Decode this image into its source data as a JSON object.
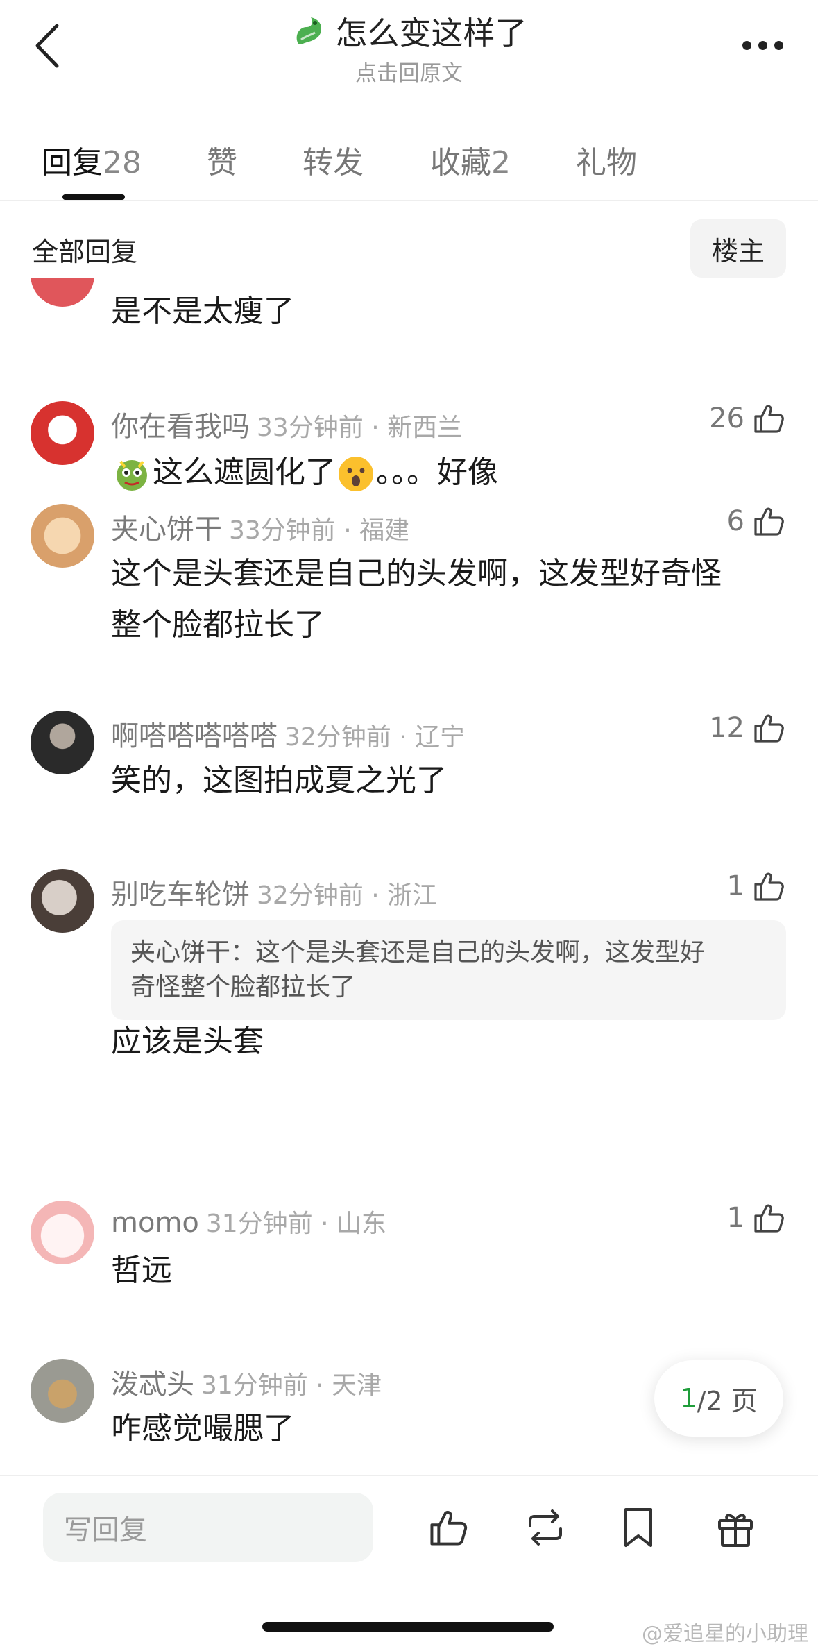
{
  "header": {
    "title": "怎么变这样了",
    "subtitle": "点击回原文"
  },
  "tabs": [
    {
      "label": "回复",
      "count": "28"
    },
    {
      "label": "赞",
      "count": ""
    },
    {
      "label": "转发",
      "count": ""
    },
    {
      "label": "收藏",
      "count": "2"
    },
    {
      "label": "礼物",
      "count": ""
    }
  ],
  "filter": {
    "label": "全部回复",
    "owner_button": "楼主"
  },
  "comments": [
    {
      "body": "是不是太瘦了"
    },
    {
      "name": "你在看我吗",
      "time": "33分钟前 · 新西兰",
      "likes": "26",
      "body_parts": [
        "这么遮圆化了",
        "。。。好像"
      ]
    },
    {
      "name": "夹心饼干",
      "time": "33分钟前 · 福建",
      "likes": "6",
      "body_line1": "这个是头套还是自己的头发啊，这发型好奇怪",
      "body_line2": "整个脸都拉长了"
    },
    {
      "name": "啊嗒嗒嗒嗒嗒",
      "time": "32分钟前 · 辽宁",
      "likes": "12",
      "body": "笑的，这图拍成夏之光了"
    },
    {
      "name": "别吃车轮饼",
      "time": "32分钟前 · 浙江",
      "likes": "1",
      "quote_line1": "夹心饼干：这个是头套还是自己的头发啊，这发型好",
      "quote_line2": "奇怪整个脸都拉长了",
      "body": "应该是头套"
    },
    {
      "name": "momo",
      "time": "31分钟前 · 山东",
      "likes": "1",
      "body": "哲远"
    },
    {
      "name": "泼忒头",
      "time": "31分钟前 · 天津",
      "likes": "",
      "body": "咋感觉嘬腮了"
    }
  ],
  "pager": {
    "current": "1",
    "total": "/2 页"
  },
  "bottom": {
    "reply_placeholder": "写回复",
    "watermark": "@爱追星的小助理"
  },
  "colors": {
    "accent_green": "#1f9d3a",
    "text_dark": "#222222",
    "text_gray": "#7a7a7a"
  }
}
